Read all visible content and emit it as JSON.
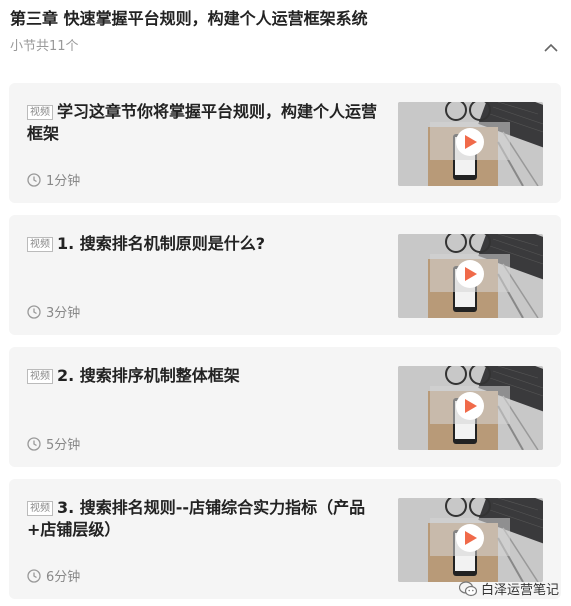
{
  "header": {
    "title": "第三章 快速掌握平台规则，构建个人运营框架系统",
    "subtitle": "小节共11个"
  },
  "lessons": [
    {
      "tag": "视频",
      "title": "学习这章节你将掌握平台规则，构建个人运营框架",
      "duration": "1分钟"
    },
    {
      "tag": "视频",
      "title": "1. 搜索排名机制原则是什么?",
      "duration": "3分钟"
    },
    {
      "tag": "视频",
      "title": "2. 搜索排序机制整体框架",
      "duration": "5分钟"
    },
    {
      "tag": "视频",
      "title": "3. 搜索排名规则--店铺综合实力指标（产品+店铺层级）",
      "duration": "6分钟"
    }
  ],
  "watermark": {
    "text": "白泽运营笔记"
  },
  "colors": {
    "card_bg": "#f5f5f5",
    "play": "#f06a4a",
    "text": "#222222",
    "muted": "#888888"
  }
}
